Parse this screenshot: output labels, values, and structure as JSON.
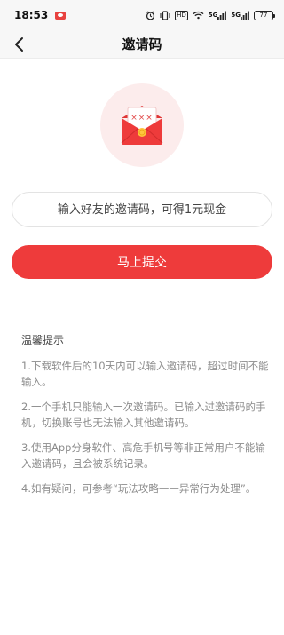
{
  "status_bar": {
    "time": "18:53",
    "network_label": "HD",
    "signal_1": "5G",
    "signal_2": "5G",
    "battery": "77"
  },
  "header": {
    "title": "邀请码",
    "back_icon": "chevron-left-icon"
  },
  "hero": {
    "icon": "red-envelope-invite-icon",
    "card_text": "×××",
    "accent_color": "#ee3b3b",
    "circle_color": "#fcecec"
  },
  "invite_form": {
    "input_placeholder": "输入好友的邀请码，可得1元现金",
    "input_value": "",
    "submit_label": "马上提交"
  },
  "tips": {
    "title": "温馨提示",
    "items": [
      "1.下载软件后的10天内可以输入邀请码，超过时间不能输入。",
      "2.一个手机只能输入一次邀请码。已输入过邀请码的手机，切换账号也无法输入其他邀请码。",
      "3.使用App分身软件、高危手机号等非正常用户不能输入邀请码，且会被系统记录。",
      "4.如有疑问，可参考“玩法攻略——异常行为处理”。"
    ]
  }
}
